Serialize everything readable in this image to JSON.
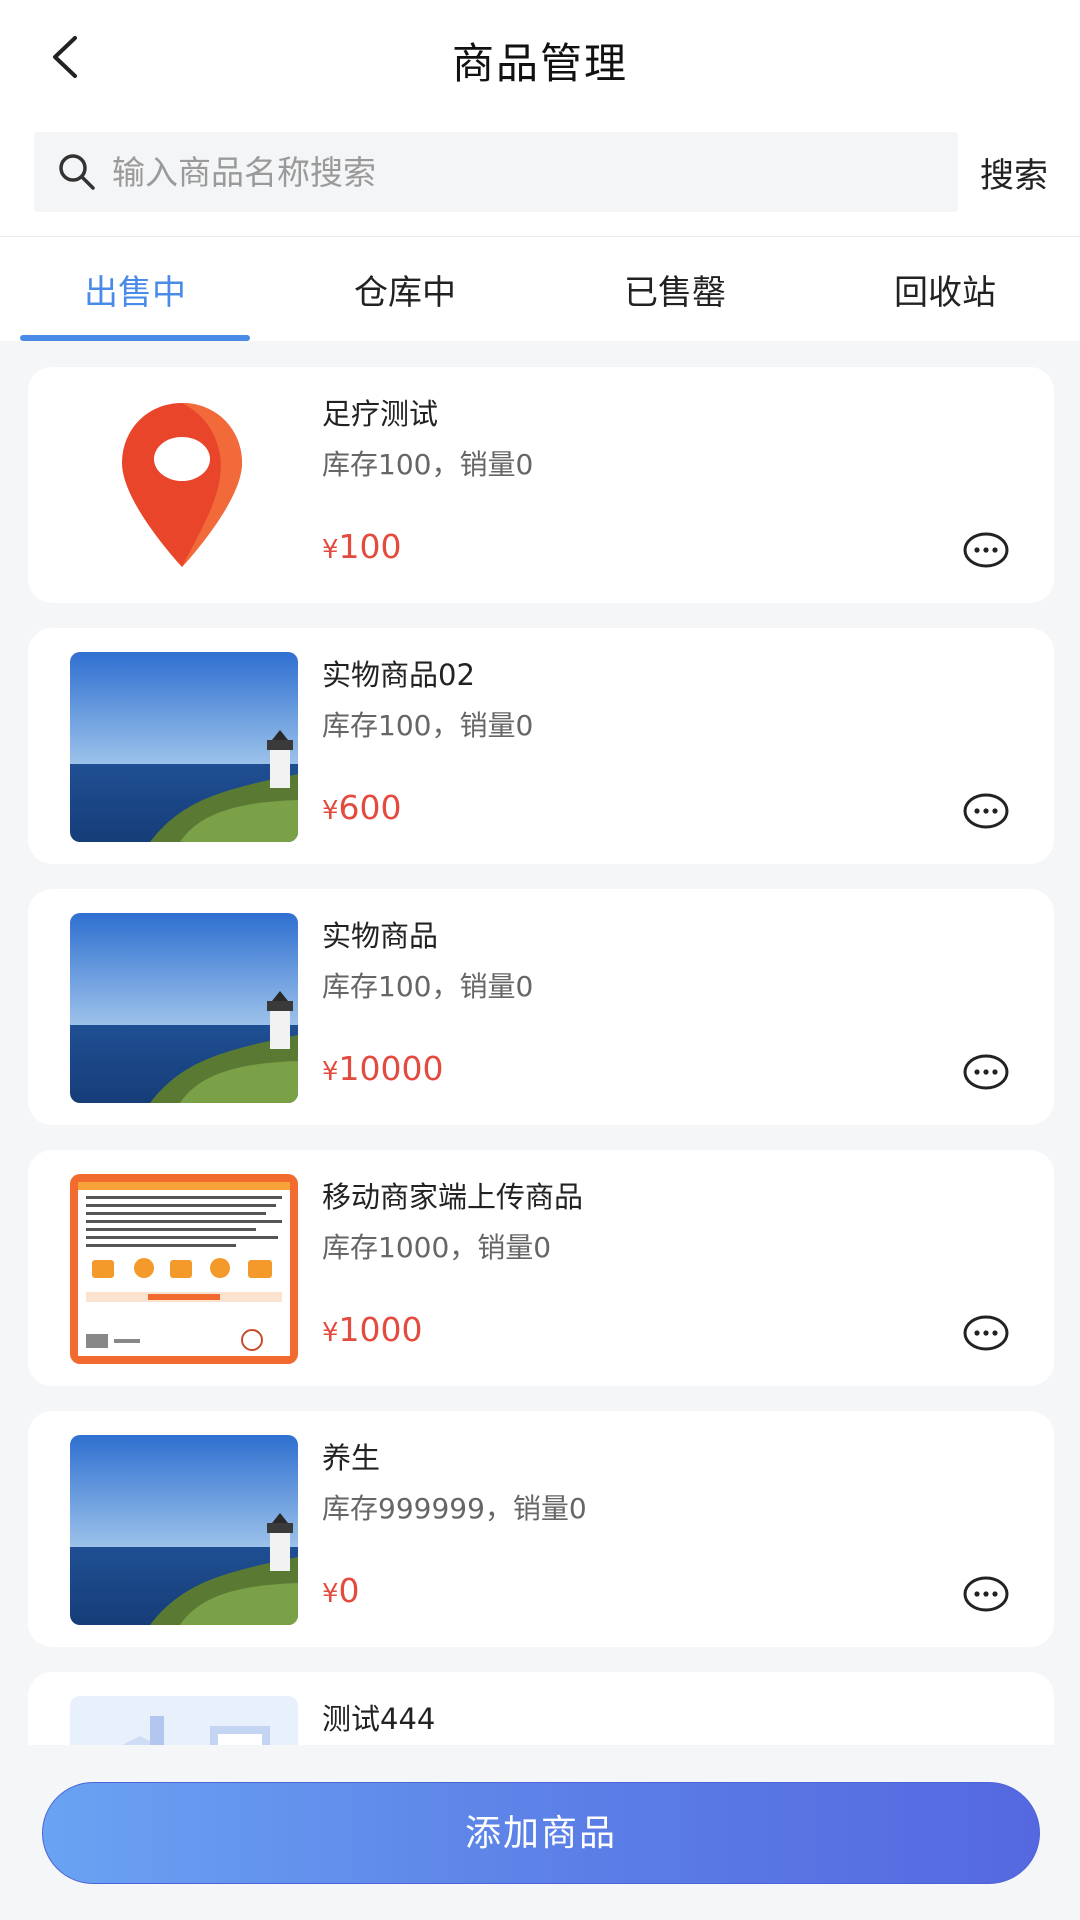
{
  "header": {
    "title": "商品管理",
    "back_icon": "chevron-left-icon"
  },
  "search": {
    "placeholder": "输入商品名称搜索",
    "value": "",
    "button_label": "搜索",
    "icon": "search-icon"
  },
  "tabs": [
    {
      "label": "出售中",
      "active": true
    },
    {
      "label": "仓库中",
      "active": false
    },
    {
      "label": "已售罄",
      "active": false
    },
    {
      "label": "回收站",
      "active": false
    }
  ],
  "products": [
    {
      "name": "足疗测试",
      "stock_sales": "库存100，销量0",
      "currency": "¥",
      "price": "100",
      "image": "location-pin"
    },
    {
      "name": "实物商品02",
      "stock_sales": "库存100，销量0",
      "currency": "¥",
      "price": "600",
      "image": "lighthouse-sea"
    },
    {
      "name": "实物商品",
      "stock_sales": "库存100，销量0",
      "currency": "¥",
      "price": "10000",
      "image": "lighthouse-sea"
    },
    {
      "name": "移动商家端上传商品",
      "stock_sales": "库存1000，销量0",
      "currency": "¥",
      "price": "1000",
      "image": "promo-poster"
    },
    {
      "name": "养生",
      "stock_sales": "库存999999，销量0",
      "currency": "¥",
      "price": "0",
      "image": "lighthouse-sea"
    },
    {
      "name": "测试444",
      "stock_sales": "",
      "currency": "",
      "price": "",
      "image": "isometric-illustration"
    }
  ],
  "footer": {
    "add_button_label": "添加商品"
  },
  "colors": {
    "accent": "#4a8be8",
    "price": "#e24b3d",
    "button_gradient_start": "#6aa3f3",
    "button_gradient_end": "#5568e0"
  }
}
